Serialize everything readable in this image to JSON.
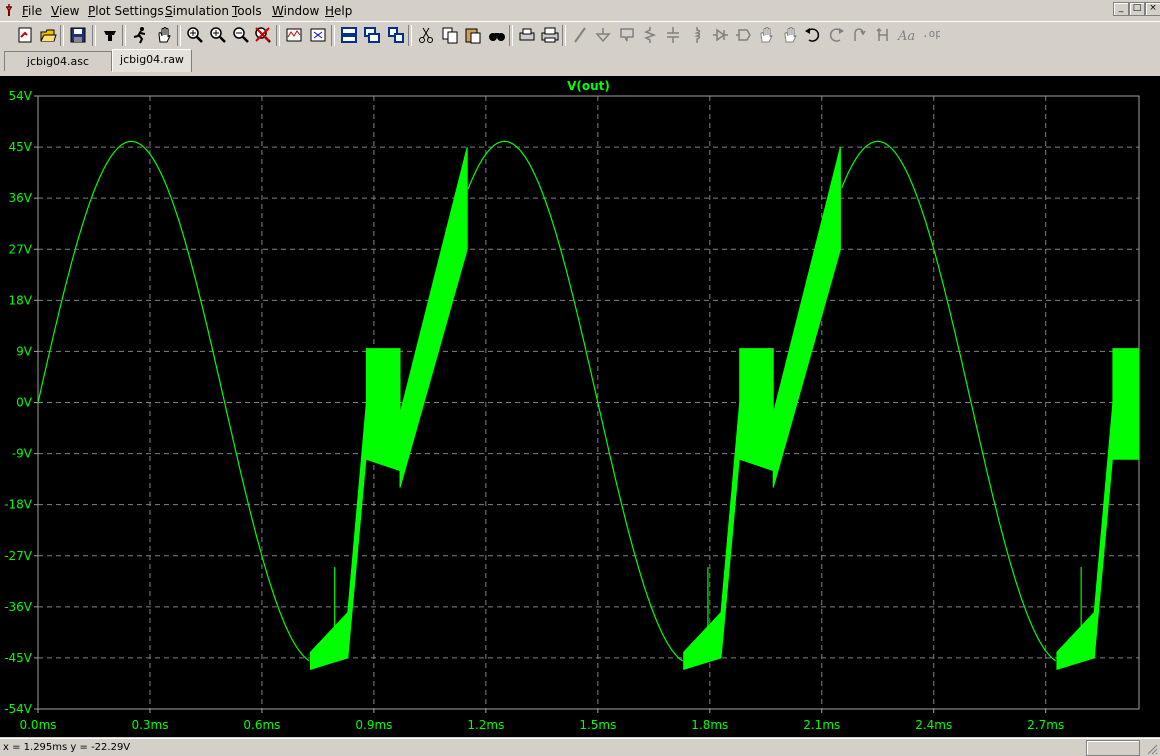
{
  "menubar": {
    "items": [
      {
        "label": "File",
        "u": "F",
        "rest": "ile"
      },
      {
        "label": "View",
        "u": "V",
        "rest": "iew"
      },
      {
        "label": "Plot Settings",
        "u": "P",
        "rest": "lot Settings"
      },
      {
        "label": "Simulation",
        "u": "S",
        "rest": "imulation"
      },
      {
        "label": "Tools",
        "u": "T",
        "rest": "ools"
      },
      {
        "label": "Window",
        "u": "W",
        "rest": "indow"
      },
      {
        "label": "Help",
        "u": "H",
        "rest": "elp"
      }
    ],
    "window_controls": [
      "_",
      "□",
      "×"
    ]
  },
  "toolbar": {
    "buttons": [
      "new-schematic-icon",
      "open-icon",
      "save-icon",
      "control-panel-icon",
      "run-icon",
      "halt-icon",
      "zoom-area-icon",
      "zoom-in-icon",
      "zoom-out-icon",
      "zoom-cancel-icon",
      "autorange-icon",
      "mark-icon",
      "tile-horizontal-icon",
      "cascade-icon",
      "tile-vertical-icon",
      "cut-icon",
      "copy-icon",
      "paste-icon",
      "find-icon",
      "print-preview-icon",
      "print-icon",
      "wire-icon",
      "ground-icon",
      "label-net-icon",
      "resistor-icon",
      "capacitor-icon",
      "inductor-icon",
      "diode-icon",
      "component-icon",
      "move-icon",
      "drag-icon",
      "undo-icon",
      "redo-icon",
      "rotate-icon",
      "mirror-icon",
      "text-icon",
      "spice-directive-icon"
    ]
  },
  "tabs": [
    {
      "label": "jcbig04.asc",
      "active": false
    },
    {
      "label": "jcbig04.raw",
      "active": true
    }
  ],
  "colors": {
    "trace": "#00ff00",
    "plot_bg": "#000000",
    "grid": "#808080",
    "axis_text": "#00ff00"
  },
  "status": {
    "text": "x = 1.295ms   y = -22.29V"
  },
  "chart_data": {
    "type": "line",
    "title": "V(out)",
    "xlabel": "",
    "ylabel": "",
    "xlim": [
      0,
      2.95
    ],
    "ylim": [
      -54,
      54
    ],
    "x_ticks": [
      "0.0ms",
      "0.3ms",
      "0.6ms",
      "0.9ms",
      "1.2ms",
      "1.5ms",
      "1.8ms",
      "2.1ms",
      "2.4ms",
      "2.7ms"
    ],
    "x_tick_values": [
      0,
      0.3,
      0.6,
      0.9,
      1.2,
      1.5,
      1.8,
      2.1,
      2.4,
      2.7
    ],
    "y_ticks": [
      "54V",
      "45V",
      "36V",
      "27V",
      "18V",
      "9V",
      "0V",
      "-9V",
      "-18V",
      "-27V",
      "-36V",
      "-45V",
      "-54V"
    ],
    "y_tick_values": [
      54,
      45,
      36,
      27,
      18,
      9,
      0,
      -9,
      -18,
      -27,
      -36,
      -45,
      -54
    ],
    "grid": true,
    "series": [
      {
        "name": "V(out)",
        "sine": {
          "amplitude_V": 46,
          "period_ms": 1.0
        },
        "points": [
          [
            0,
            0
          ],
          [
            0.05,
            13.5
          ],
          [
            0.1,
            27
          ],
          [
            0.15,
            37.2
          ],
          [
            0.2,
            43.7
          ],
          [
            0.25,
            46
          ],
          [
            0.3,
            43.7
          ],
          [
            0.35,
            37.2
          ],
          [
            0.4,
            27
          ],
          [
            0.45,
            14.2
          ],
          [
            0.5,
            0
          ],
          [
            0.55,
            -14.2
          ],
          [
            0.6,
            -27
          ],
          [
            0.65,
            -37.2
          ],
          [
            0.7,
            -43.7
          ],
          [
            0.73,
            -45.5
          ],
          [
            0.9,
            -9
          ],
          [
            0.97,
            9
          ],
          [
            1.1,
            27
          ],
          [
            1.2,
            43.7
          ],
          [
            1.25,
            46
          ],
          [
            1.3,
            43.7
          ],
          [
            1.35,
            37.2
          ],
          [
            1.4,
            27
          ],
          [
            1.45,
            14.2
          ],
          [
            1.5,
            0
          ],
          [
            1.55,
            -14.2
          ],
          [
            1.6,
            -27
          ],
          [
            1.65,
            -37.2
          ],
          [
            1.7,
            -43.7
          ],
          [
            1.73,
            -45.5
          ],
          [
            1.9,
            -9
          ],
          [
            1.97,
            9
          ],
          [
            2.1,
            27
          ],
          [
            2.2,
            43.7
          ],
          [
            2.25,
            46
          ],
          [
            2.3,
            43.7
          ],
          [
            2.35,
            37.2
          ],
          [
            2.4,
            27
          ],
          [
            2.45,
            14.2
          ],
          [
            2.5,
            0
          ],
          [
            2.55,
            -14.2
          ],
          [
            2.6,
            -27
          ],
          [
            2.65,
            -37.2
          ],
          [
            2.7,
            -43.7
          ],
          [
            2.73,
            -45.5
          ],
          [
            2.9,
            -9
          ],
          [
            2.95,
            9
          ]
        ],
        "oscillation_bands": [
          {
            "x": [
              0.73,
              0.83
            ],
            "low": [
              -47,
              -45
            ],
            "high": [
              -44,
              -37
            ]
          },
          {
            "x": [
              0.83,
              0.88
            ],
            "low": [
              -45,
              -9
            ],
            "high": [
              -37,
              0
            ]
          },
          {
            "x": [
              0.88,
              0.97
            ],
            "low": [
              -10,
              -12
            ],
            "high": [
              9.5,
              9.5
            ]
          },
          {
            "x": [
              0.97,
              1.15
            ],
            "low": [
              -15,
              27
            ],
            "high": [
              -2,
              45
            ]
          },
          {
            "x": [
              1.73,
              1.83
            ],
            "low": [
              -47,
              -45
            ],
            "high": [
              -44,
              -37
            ]
          },
          {
            "x": [
              1.83,
              1.88
            ],
            "low": [
              -45,
              -9
            ],
            "high": [
              -37,
              0
            ]
          },
          {
            "x": [
              1.88,
              1.97
            ],
            "low": [
              -10,
              -12
            ],
            "high": [
              9.5,
              9.5
            ]
          },
          {
            "x": [
              1.97,
              2.15
            ],
            "low": [
              -15,
              27
            ],
            "high": [
              -2,
              45
            ]
          },
          {
            "x": [
              2.73,
              2.83
            ],
            "low": [
              -47,
              -45
            ],
            "high": [
              -44,
              -37
            ]
          },
          {
            "x": [
              2.83,
              2.88
            ],
            "low": [
              -45,
              -9
            ],
            "high": [
              -37,
              0
            ]
          },
          {
            "x": [
              2.88,
              2.95
            ],
            "low": [
              -10,
              -10
            ],
            "high": [
              9.5,
              9.5
            ]
          }
        ]
      }
    ]
  }
}
